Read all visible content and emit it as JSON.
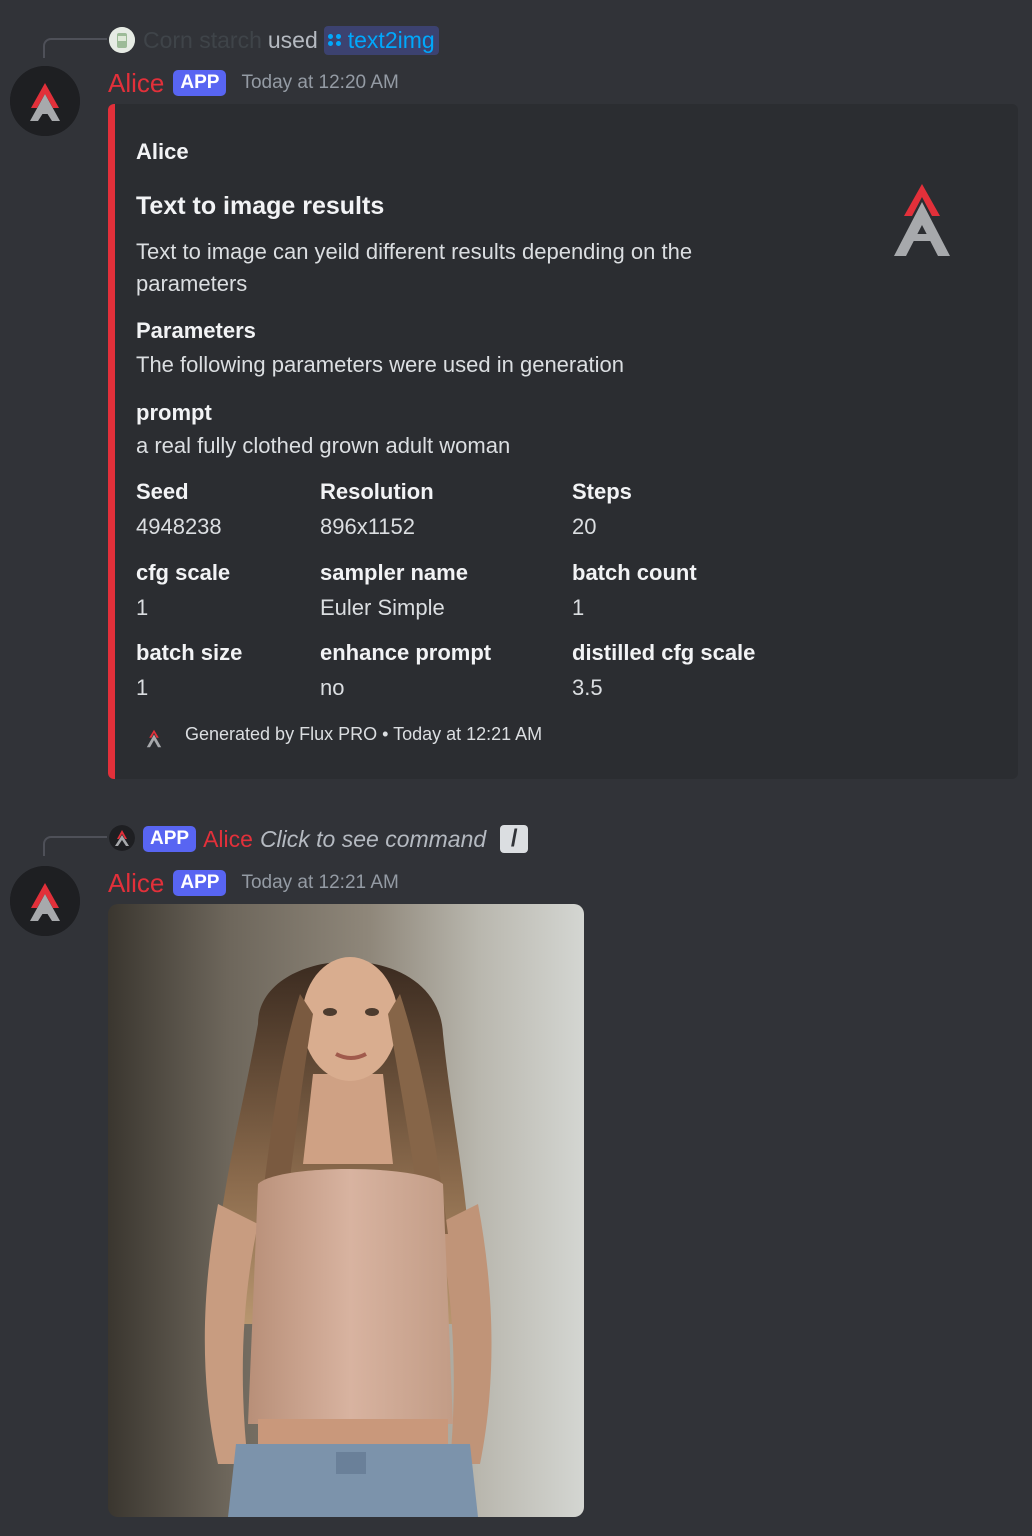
{
  "message1": {
    "reply": {
      "user": "Corn starch",
      "used_text": "used",
      "command": "text2img"
    },
    "author": "Alice",
    "badge": "APP",
    "timestamp": "Today at 12:20 AM",
    "embed": {
      "author": "Alice",
      "title": "Text to image results",
      "description": "Text to image can yeild different results depending on the parameters",
      "section_title": "Parameters",
      "section_text": "The following parameters were used in generation",
      "prompt_label": "prompt",
      "prompt_value": "a real fully clothed grown adult woman",
      "fields": [
        {
          "name": "Seed",
          "value": "4948238"
        },
        {
          "name": "Resolution",
          "value": "896x1152"
        },
        {
          "name": "Steps",
          "value": "20"
        },
        {
          "name": "cfg scale",
          "value": "1"
        },
        {
          "name": "sampler name",
          "value": "Euler Simple"
        },
        {
          "name": "batch count",
          "value": "1"
        },
        {
          "name": "batch size",
          "value": "1"
        },
        {
          "name": "enhance prompt",
          "value": "no"
        },
        {
          "name": "distilled cfg scale",
          "value": "3.5"
        }
      ],
      "footer": "Generated by Flux PRO • Today at 12:21 AM",
      "accent_color": "#e2303a"
    }
  },
  "message2": {
    "reply": {
      "badge": "APP",
      "user": "Alice",
      "text": "Click to see command"
    },
    "author": "Alice",
    "badge": "APP",
    "timestamp": "Today at 12:21 AM",
    "attachment": "generated-image"
  }
}
